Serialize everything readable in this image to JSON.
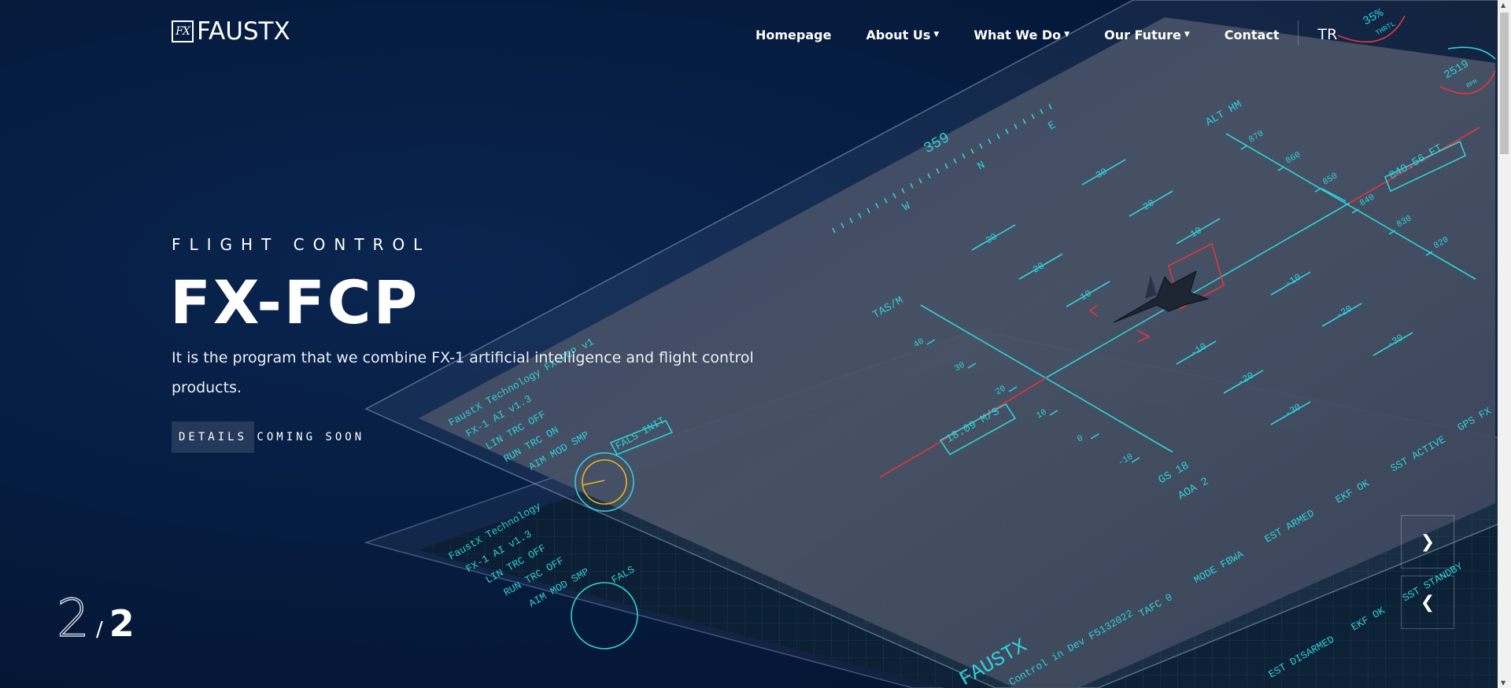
{
  "brand": {
    "logo_mark": "FX",
    "name": "FAUSTX"
  },
  "nav": {
    "items": [
      {
        "label": "Homepage",
        "dropdown": false
      },
      {
        "label": "About Us",
        "dropdown": true
      },
      {
        "label": "What We Do",
        "dropdown": true
      },
      {
        "label": "Our Future",
        "dropdown": true
      },
      {
        "label": "Contact",
        "dropdown": false
      }
    ],
    "language": "TR"
  },
  "hero": {
    "subtitle": "FLIGHT CONTROL",
    "title": "FX-FCP",
    "description": "It is the program that we combine FX-1 artificial intelligence and flight control products.",
    "cta_label": "DETAILS COMING SOON"
  },
  "slider": {
    "current": "2",
    "separator": "/",
    "total": "2",
    "next_icon": "chevron-right-icon",
    "prev_icon": "chevron-left-icon"
  },
  "hud": {
    "heading": "359",
    "compass": [
      "W",
      "N",
      "E"
    ],
    "pitch_up": [
      "30",
      "20",
      "10",
      "30",
      "20",
      "10"
    ],
    "pitch_down": [
      "-10",
      "-20",
      "-30",
      "-10",
      "-20",
      "-30"
    ],
    "alt_label": "ALT HM",
    "alt_ticks": [
      "870",
      "860",
      "850",
      "840",
      "830",
      "820"
    ],
    "alt_box": "840.56 FT",
    "tas_label": "TAS/M",
    "tas_ticks": [
      "40",
      "30",
      "20",
      "10",
      "0",
      "-10"
    ],
    "tas_box": "18.09 M/S",
    "gs": "GS 18",
    "aoa": "AOA 2",
    "status_left": [
      "FaustX Technology FX-FCP v1",
      "FX-1 AI v1.3",
      "LIN TRC  OFF",
      "RUN TRC  ON",
      "AIM MOD  SMP"
    ],
    "fals_init": "FALS INIT",
    "status_bottom": [
      "TAFC 0",
      "MODE FBWA",
      "EST ARMED",
      "EKF OK",
      "SST ACTIVE",
      "GPS FX"
    ],
    "status_bottom2": [
      "EST DISARMED",
      "EKF OK",
      "SST STANDBY"
    ],
    "footer_line": "Control in Dev F5132022",
    "lower_panel": [
      "FaustX Technology",
      "FX-1 AI v1.3",
      "LIN TRC  OFF",
      "RUN TRC  OFF",
      "AIM MOD  SMP",
      "FALS"
    ],
    "brand_bottom": "FAUSTX",
    "throttle": "35%",
    "throttle_label": "THRTL",
    "rpm": "2519",
    "rpm_label": "RPM",
    "colors": {
      "cyan": "#2fd0d8",
      "red": "#e0373a",
      "green": "#3ee36a",
      "yellow": "#e6b51f"
    }
  }
}
